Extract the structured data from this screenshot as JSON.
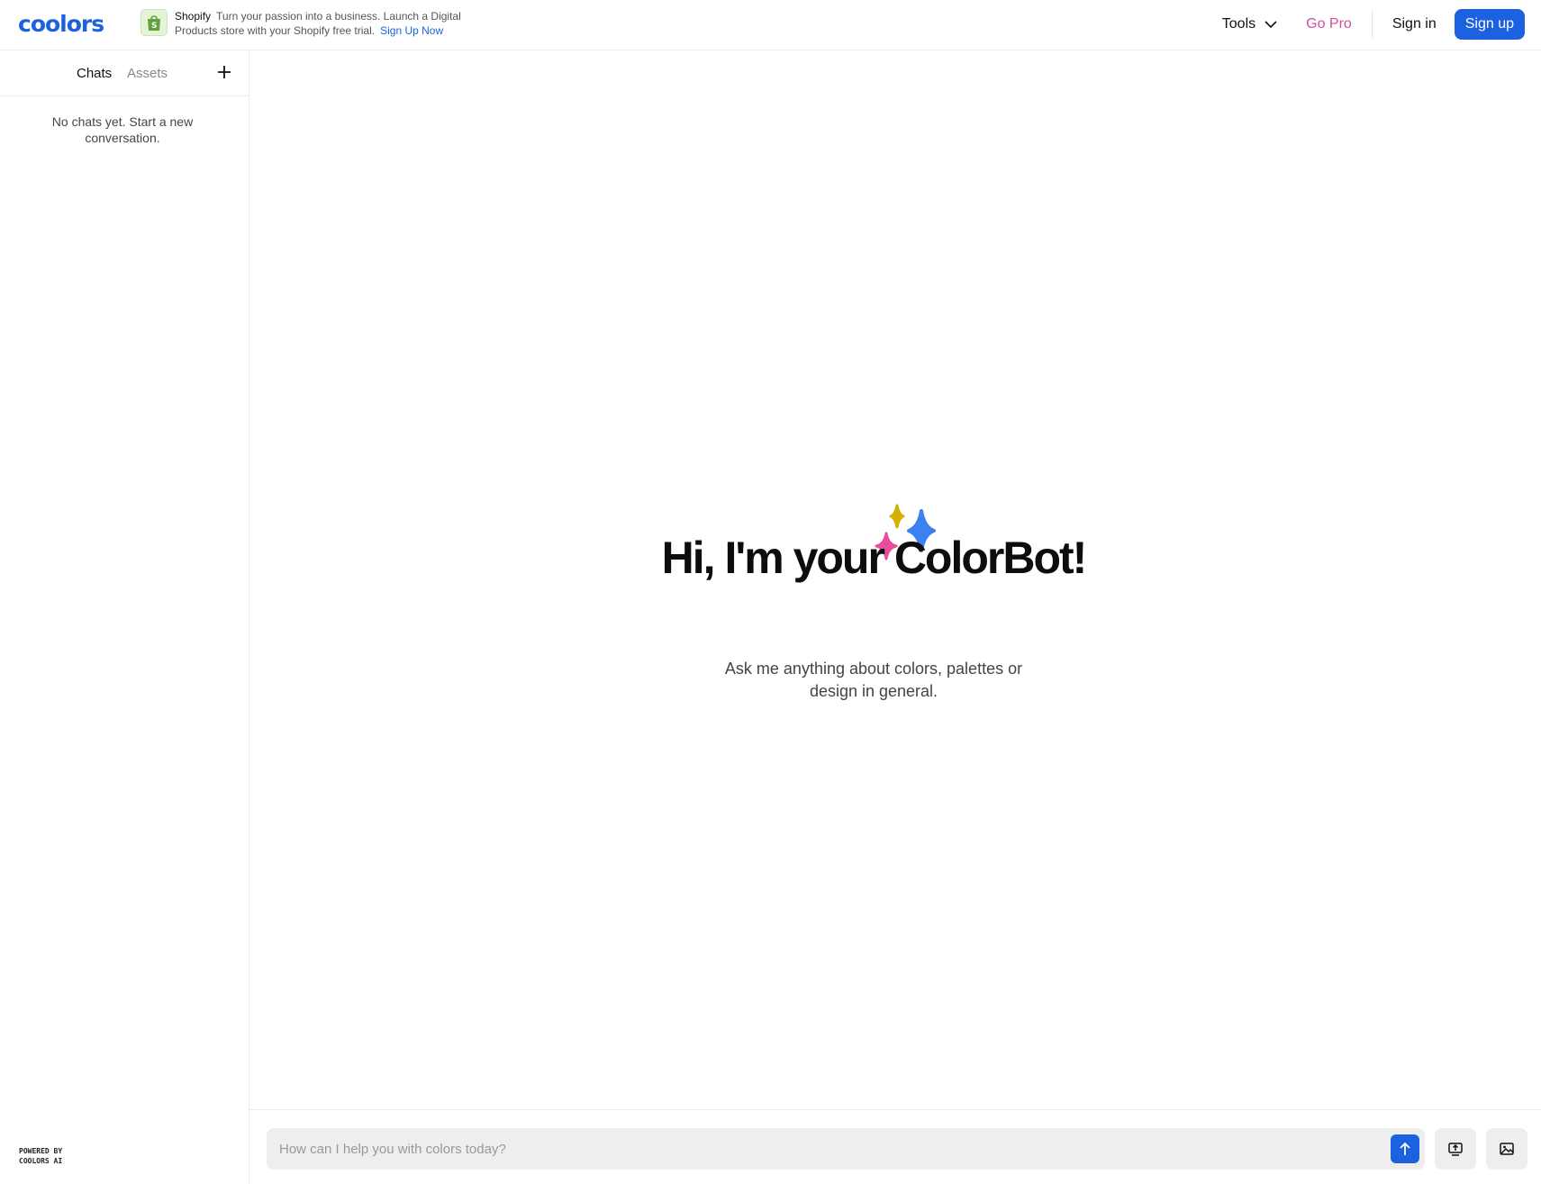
{
  "header": {
    "logo": "coolors",
    "ad": {
      "brand": "Shopify",
      "text": "Turn your passion into a business. Launch a Digital Products store with your Shopify free trial.",
      "cta": "Sign Up Now"
    },
    "nav": {
      "tools": "Tools",
      "go_pro": "Go Pro",
      "sign_in": "Sign in",
      "sign_up": "Sign up"
    }
  },
  "sidebar": {
    "tabs": [
      {
        "label": "Chats",
        "active": true
      },
      {
        "label": "Assets",
        "active": false
      }
    ],
    "empty_message": "No chats yet. Start a new conversation.",
    "powered_by_line1": "POWERED BY",
    "powered_by_line2": "COOLORS AI"
  },
  "main": {
    "heading": "Hi, I'm your ColorBot!",
    "subtitle": "Ask me anything about colors, palettes or design in general.",
    "input_placeholder": "How can I help you with colors today?"
  },
  "icons": [
    "shopify-bag-icon",
    "chevron-down-icon",
    "plus-icon",
    "sparkles-icon",
    "arrow-up-icon",
    "upload-icon",
    "image-icon"
  ],
  "colors": {
    "accent": "#1c62e0",
    "go_pro": "#d64b9d",
    "sparkle_yellow": "#d4b000",
    "sparkle_pink": "#e84d9d",
    "sparkle_blue": "#3b82f0"
  }
}
